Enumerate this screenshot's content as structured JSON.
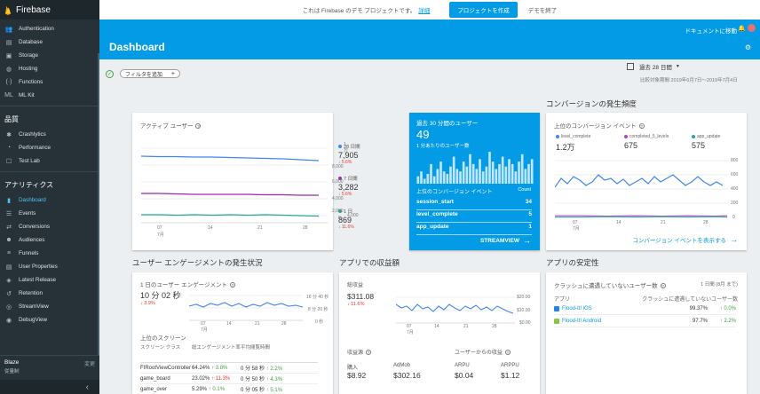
{
  "topbar": {
    "notice": "これは Firebase のデモ プロジェクトです。",
    "details_link": "詳細",
    "create_button": "プロジェクトを作成",
    "exit_demo": "デモを終了"
  },
  "sidebar": {
    "brand": "Firebase",
    "develop_items": [
      {
        "label": "Authentication",
        "icon": "people-icon"
      },
      {
        "label": "Database",
        "icon": "database-icon"
      },
      {
        "label": "Storage",
        "icon": "storage-icon"
      },
      {
        "label": "Hosting",
        "icon": "globe-icon"
      },
      {
        "label": "Functions",
        "icon": "functions-icon"
      },
      {
        "label": "ML Kit",
        "icon": "ml-kit-icon"
      }
    ],
    "quality_title": "品質",
    "quality_items": [
      {
        "label": "Crashlytics",
        "icon": "crashlytics-icon"
      },
      {
        "label": "Performance",
        "icon": "performance-icon"
      },
      {
        "label": "Test Lab",
        "icon": "test-lab-icon"
      }
    ],
    "analytics_title": "アナリティクス",
    "analytics_items": [
      {
        "label": "Dashboard",
        "icon": "bar-chart-icon"
      },
      {
        "label": "Events",
        "icon": "events-icon"
      },
      {
        "label": "Conversions",
        "icon": "conversions-icon"
      },
      {
        "label": "Audiences",
        "icon": "audiences-icon"
      },
      {
        "label": "Funnels",
        "icon": "funnels-icon"
      },
      {
        "label": "User Properties",
        "icon": "user-properties-icon"
      },
      {
        "label": "Latest Release",
        "icon": "latest-release-icon"
      },
      {
        "label": "Retention",
        "icon": "retention-icon"
      },
      {
        "label": "StreamView",
        "icon": "streamview-icon"
      },
      {
        "label": "DebugView",
        "icon": "debugview-icon"
      }
    ],
    "plan_name": "Blaze",
    "plan_sub": "従量制",
    "plan_change": "変更",
    "collapse": "‹"
  },
  "header": {
    "title": "Dashboard",
    "docs_link": "ドキュメントに移動"
  },
  "filter": {
    "chip_label": "フィルタを追加",
    "date_range": "過去 28 日間",
    "compare_period": "比較対象期間 2019年6月7日～2019年7月4日"
  },
  "sections": {
    "conversions_title": "コンバージョンの発生頻度",
    "engagement_title": "ユーザー エンゲージメントの発生状況",
    "revenue_title": "アプリでの収益額",
    "stability_title": "アプリの安定性"
  },
  "active_users": {
    "title": "アクティブ ユーザー",
    "legend": [
      {
        "label": "28 日間",
        "value": "7,905",
        "change": "↓ 5.6%",
        "color": "#4285f4"
      },
      {
        "label": "7 日間",
        "value": "3,282",
        "change": "↓ 5.6%",
        "color": "#9c27b0"
      },
      {
        "label": "1 日",
        "value": "869",
        "change": "↓ 11.6%",
        "color": "#26a69a"
      }
    ],
    "y_ticks": [
      "1万",
      "8,000",
      "6,000",
      "4,000",
      "2,000",
      "0"
    ],
    "x_ticks": [
      "07",
      "14",
      "21",
      "28"
    ],
    "x_month": "7月"
  },
  "realtime": {
    "title": "過去 30 分間のユーザー",
    "value": "49",
    "subtitle": "1 分あたりのユーザー数",
    "conv_header": "上位のコンバージョン イベント",
    "count_header": "Count",
    "rows": [
      {
        "name": "session_start",
        "count": "34"
      },
      {
        "name": "level_complete",
        "count": "5"
      },
      {
        "name": "app_update",
        "count": "1"
      }
    ],
    "streamview": "STREAMVIEW",
    "bars": [
      3,
      5,
      2,
      4,
      8,
      3,
      6,
      9,
      5,
      4,
      7,
      11,
      6,
      5,
      9,
      7,
      12,
      8,
      6,
      10,
      5,
      7,
      13,
      9,
      6,
      8,
      11,
      7,
      10,
      8,
      5,
      9,
      12,
      6,
      8,
      10
    ]
  },
  "conversions": {
    "title": "上位のコンバージョン イベント",
    "legend": [
      {
        "label": "level_complete",
        "value": "1.2万",
        "color": "#4285f4"
      },
      {
        "label": "completed_5_levels",
        "value": "675",
        "color": "#ab47bc"
      },
      {
        "label": "app_update",
        "value": "575",
        "color": "#26a69a"
      }
    ],
    "y_ticks": [
      "800",
      "600",
      "400",
      "200",
      "0"
    ],
    "x_ticks": [
      "07",
      "14",
      "21",
      "28"
    ],
    "x_month": "7月",
    "link": "コンバージョン イベントを表示する"
  },
  "engagement": {
    "title": "1 日のユーザー エンゲージメント",
    "value": "10 分 02 秒",
    "change": "↓ 3.9%",
    "y_ticks": [
      "16 分 40 秒",
      "8 分 20 秒",
      "0 秒"
    ],
    "x_ticks": [
      "07",
      "14",
      "21",
      "28"
    ],
    "x_month": "7月",
    "screens_title": "上位のスクリーン",
    "headers": [
      "スクリーン クラス",
      "総エンゲージメント率",
      "平均閲覧時間"
    ],
    "rows": [
      {
        "name": "FIRootViewController",
        "pct": "64.24%",
        "pct_chg": "↑ 3.8%",
        "time": "0 分 58 秒",
        "time_chg": "↑ 2.2%"
      },
      {
        "name": "game_board",
        "pct": "23.02%",
        "pct_chg": "↑ 11.3%",
        "time": "0 分 50 秒",
        "time_chg": "↑ 4.3%"
      },
      {
        "name": "game_over",
        "pct": "5.29%",
        "pct_chg": "↑ 0.1%",
        "time": "0 分 05 秒",
        "time_chg": "↑ 5.1%"
      }
    ]
  },
  "revenue": {
    "total_label": "総収益",
    "total_value": "$311.08",
    "total_change": "↓ 11.6%",
    "y_ticks": [
      "$20.00",
      "$10.00",
      "$0.00"
    ],
    "x_ticks": [
      "07",
      "14",
      "21",
      "28"
    ],
    "x_month": "7月",
    "breakdown_label": "収益源",
    "user_label": "ユーザーからの収益",
    "purchase_label": "購入",
    "purchase_value": "$8.92",
    "admob_label": "AdMob",
    "admob_value": "$302.16",
    "arpu_label": "ARPU",
    "arpu_value": "$0.04",
    "arppu_label": "ARPPU",
    "arppu_value": "$1.12"
  },
  "stability": {
    "title": "クラッシュに遭遇していないユーザー数",
    "period": "1 日間 (8月 まで)",
    "col_app": "アプリ",
    "col_rate": "クラッシュに遭遇していないユーザー数",
    "rows": [
      {
        "name": "Flood-It! iOS",
        "pct": "99.37%",
        "chg": "↑ 0.0%",
        "color": "#1e88e5"
      },
      {
        "name": "Flood-It! Android",
        "pct": "97.7%",
        "chg": "↑ 2.2%",
        "color": "#8bc34a"
      }
    ]
  }
}
